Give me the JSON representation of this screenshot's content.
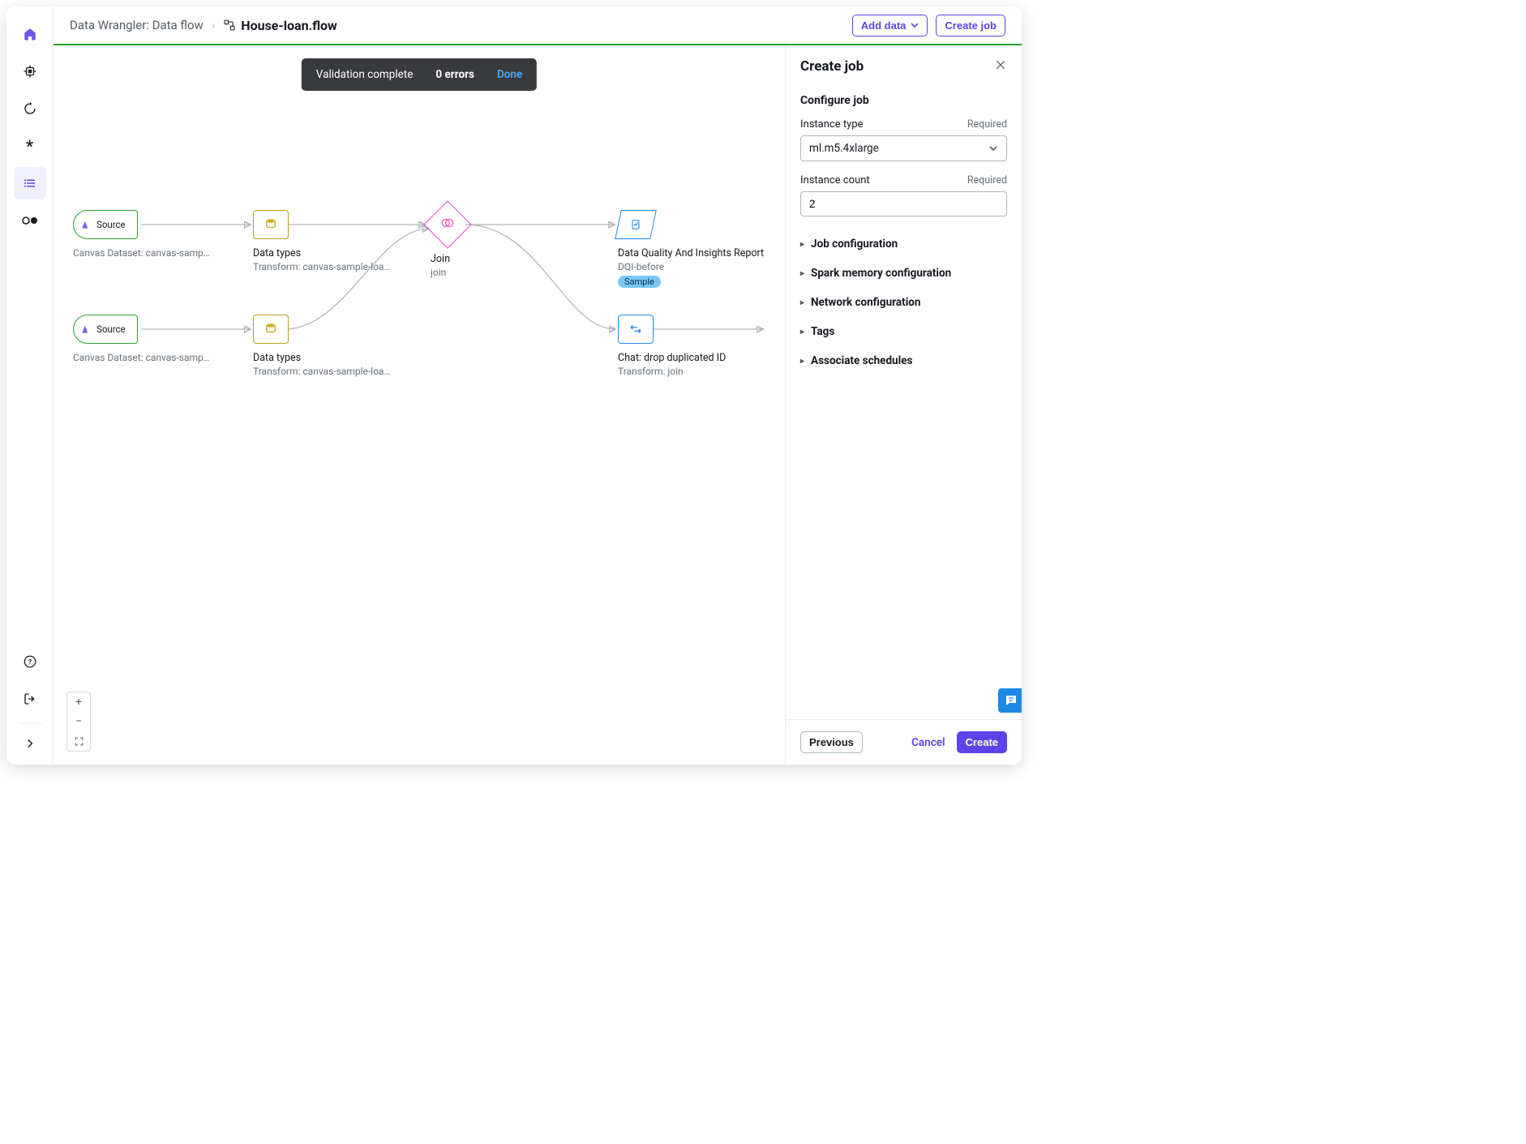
{
  "breadcrumb": {
    "root": "Data Wrangler: Data flow",
    "file": "House-loan.flow"
  },
  "topbar": {
    "add_data": "Add data",
    "create_job": "Create job"
  },
  "toast": {
    "status": "Validation complete",
    "errors": "0 errors",
    "done": "Done"
  },
  "nodes": {
    "src1": {
      "label": "Source",
      "title": "Canvas Dataset: canvas-sample-loans-…"
    },
    "src2": {
      "label": "Source",
      "title": "Canvas Dataset: canvas-sample-loans-…"
    },
    "dt1": {
      "title": "Data types",
      "sub": "Transform: canvas-sample-loans-part-…"
    },
    "dt2": {
      "title": "Data types",
      "sub": "Transform: canvas-sample-loans-part-…"
    },
    "join": {
      "title": "Join",
      "sub": "join"
    },
    "dqi": {
      "title": "Data Quality And Insights Report",
      "sub": "DQI-before",
      "badge": "Sample"
    },
    "chat": {
      "title": "Chat: drop duplicated ID",
      "sub": "Transform: join"
    }
  },
  "panel": {
    "title": "Create job",
    "section": "Configure job",
    "instance_type_label": "Instance type",
    "instance_type_value": "ml.m5.4xlarge",
    "instance_count_label": "Instance count",
    "instance_count_value": "2",
    "required": "Required",
    "acc": {
      "job_config": "Job configuration",
      "spark": "Spark memory configuration",
      "network": "Network configuration",
      "tags": "Tags",
      "schedules": "Associate schedules"
    },
    "footer": {
      "previous": "Previous",
      "cancel": "Cancel",
      "create": "Create"
    }
  }
}
